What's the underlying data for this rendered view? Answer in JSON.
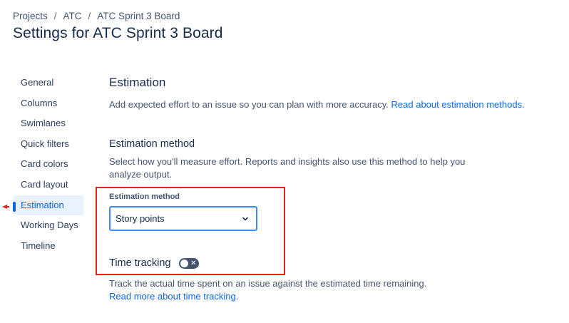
{
  "breadcrumb": {
    "items": [
      "Projects",
      "ATC",
      "ATC Sprint 3 Board"
    ],
    "separator": "/"
  },
  "page": {
    "title": "Settings for ATC Sprint 3 Board"
  },
  "sidebar": {
    "items": [
      {
        "label": "General"
      },
      {
        "label": "Columns"
      },
      {
        "label": "Swimlanes"
      },
      {
        "label": "Quick filters"
      },
      {
        "label": "Card colors"
      },
      {
        "label": "Card layout"
      },
      {
        "label": "Estimation"
      },
      {
        "label": "Working Days"
      },
      {
        "label": "Timeline"
      }
    ],
    "selected": "Estimation"
  },
  "estimation": {
    "title": "Estimation",
    "intro": "Add expected effort to an issue so you can plan with more accuracy.",
    "intro_link": "Read about estimation methods.",
    "method_heading": "Estimation method",
    "method_desc": "Select how you'll measure effort. Reports and insights also use this method to help you analyze output.",
    "field_label": "Estimation method",
    "selected_value": "Story points"
  },
  "time_tracking": {
    "label": "Time tracking",
    "enabled": false,
    "toggle_glyph": "✕",
    "desc": "Track the actual time spent on an issue against the estimated time remaining.",
    "link": "Read more about time tracking."
  },
  "colors": {
    "accent": "#0c66e4",
    "annotation": "#e2231a",
    "selected_bg": "#e9f2ff"
  }
}
